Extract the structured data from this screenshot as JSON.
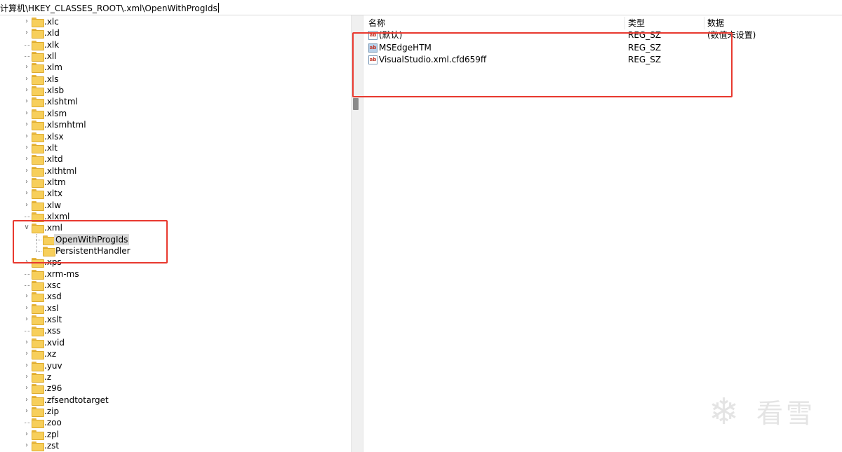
{
  "address": {
    "path": "计算机\\HKEY_CLASSES_ROOT\\.xml\\OpenWithProgIds"
  },
  "tree": {
    "items": [
      {
        "label": ".xlc",
        "indent": 0,
        "expand": "collapsed"
      },
      {
        "label": ".xld",
        "indent": 0,
        "expand": "collapsed"
      },
      {
        "label": ".xlk",
        "indent": 0,
        "expand": "none"
      },
      {
        "label": ".xll",
        "indent": 0,
        "expand": "none"
      },
      {
        "label": ".xlm",
        "indent": 0,
        "expand": "collapsed"
      },
      {
        "label": ".xls",
        "indent": 0,
        "expand": "collapsed"
      },
      {
        "label": ".xlsb",
        "indent": 0,
        "expand": "collapsed"
      },
      {
        "label": ".xlshtml",
        "indent": 0,
        "expand": "collapsed"
      },
      {
        "label": ".xlsm",
        "indent": 0,
        "expand": "collapsed"
      },
      {
        "label": ".xlsmhtml",
        "indent": 0,
        "expand": "collapsed"
      },
      {
        "label": ".xlsx",
        "indent": 0,
        "expand": "collapsed"
      },
      {
        "label": ".xlt",
        "indent": 0,
        "expand": "collapsed"
      },
      {
        "label": ".xltd",
        "indent": 0,
        "expand": "collapsed"
      },
      {
        "label": ".xlthtml",
        "indent": 0,
        "expand": "collapsed"
      },
      {
        "label": ".xltm",
        "indent": 0,
        "expand": "collapsed"
      },
      {
        "label": ".xltx",
        "indent": 0,
        "expand": "collapsed"
      },
      {
        "label": ".xlw",
        "indent": 0,
        "expand": "collapsed"
      },
      {
        "label": ".xlxml",
        "indent": 0,
        "expand": "none"
      },
      {
        "label": ".xml",
        "indent": 0,
        "expand": "expanded"
      },
      {
        "label": "OpenWithProgIds",
        "indent": 1,
        "expand": "none",
        "selected": true
      },
      {
        "label": "PersistentHandler",
        "indent": 1,
        "expand": "none"
      },
      {
        "label": ".xps",
        "indent": 0,
        "expand": "collapsed"
      },
      {
        "label": ".xrm-ms",
        "indent": 0,
        "expand": "none"
      },
      {
        "label": ".xsc",
        "indent": 0,
        "expand": "none"
      },
      {
        "label": ".xsd",
        "indent": 0,
        "expand": "collapsed"
      },
      {
        "label": ".xsl",
        "indent": 0,
        "expand": "collapsed"
      },
      {
        "label": ".xslt",
        "indent": 0,
        "expand": "collapsed"
      },
      {
        "label": ".xss",
        "indent": 0,
        "expand": "none"
      },
      {
        "label": ".xvid",
        "indent": 0,
        "expand": "collapsed"
      },
      {
        "label": ".xz",
        "indent": 0,
        "expand": "collapsed"
      },
      {
        "label": ".yuv",
        "indent": 0,
        "expand": "collapsed"
      },
      {
        "label": ".z",
        "indent": 0,
        "expand": "collapsed"
      },
      {
        "label": ".z96",
        "indent": 0,
        "expand": "collapsed"
      },
      {
        "label": ".zfsendtotarget",
        "indent": 0,
        "expand": "collapsed"
      },
      {
        "label": ".zip",
        "indent": 0,
        "expand": "collapsed"
      },
      {
        "label": ".zoo",
        "indent": 0,
        "expand": "none"
      },
      {
        "label": ".zpl",
        "indent": 0,
        "expand": "collapsed"
      },
      {
        "label": ".zst",
        "indent": 0,
        "expand": "collapsed"
      }
    ]
  },
  "values": {
    "headers": {
      "name": "名称",
      "type": "类型",
      "data": "数据"
    },
    "icon_text": "ab",
    "rows": [
      {
        "name": "(默认)",
        "type": "REG_SZ",
        "data": "(数值未设置)",
        "icon_style": "plain"
      },
      {
        "name": "MSEdgeHTM",
        "type": "REG_SZ",
        "data": "",
        "icon_style": "blue"
      },
      {
        "name": "VisualStudio.xml.cfd659ff",
        "type": "REG_SZ",
        "data": "",
        "icon_style": "plain"
      }
    ]
  },
  "watermark": {
    "text": "看雪",
    "symbol": "❄"
  },
  "colors": {
    "highlight": "#e8392f",
    "folder": "#f7cf5b",
    "selection": "#d9d9d9"
  }
}
